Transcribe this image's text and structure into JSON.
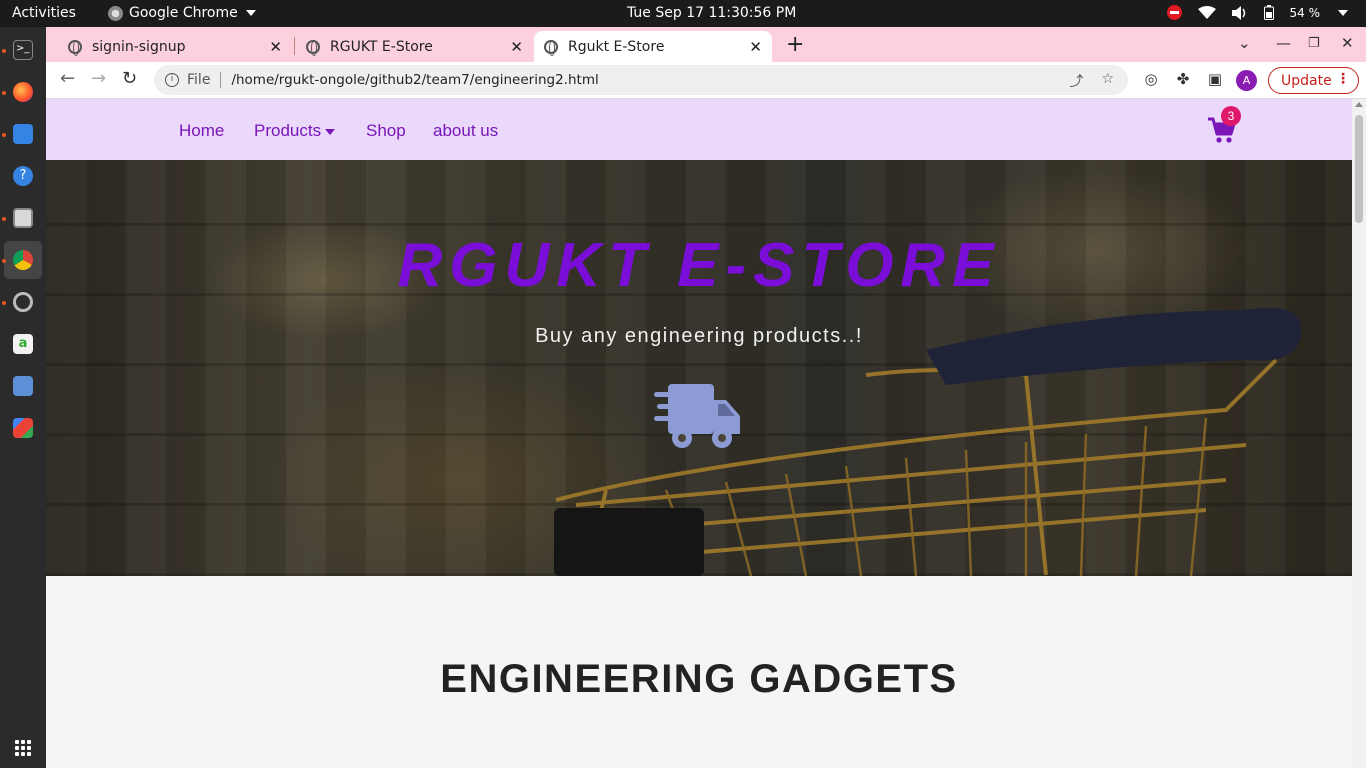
{
  "topbar": {
    "activities": "Activities",
    "app_name": "Google Chrome",
    "clock": "Tue Sep 17  11:30:56 PM",
    "battery": "54 %"
  },
  "dock": {
    "items": [
      "terminal-icon",
      "firefox-icon",
      "text-editor-icon",
      "help-icon",
      "files-icon",
      "chrome-icon",
      "settings-icon",
      "software-icon",
      "package-icon",
      "gmail-icon",
      "show-apps-icon"
    ]
  },
  "browser": {
    "tabs": [
      {
        "title": "signin-signup"
      },
      {
        "title": "RGUKT E-Store"
      },
      {
        "title": "Rgukt E-Store"
      }
    ],
    "new_tab_label": "+",
    "omnibox": {
      "scheme_label": "File",
      "url": "/home/rgukt-ongole/github2/team7/engineering2.html"
    },
    "avatar_letter": "A",
    "update_label": "Update"
  },
  "site": {
    "nav": {
      "home": "Home",
      "products": "Products",
      "shop": "Shop",
      "about": "about us"
    },
    "cart_count": "3",
    "hero": {
      "title": "RGUKT E-STORE",
      "subtitle": "Buy any engineering products..!"
    },
    "section_title": "ENGINEERING GADGETS"
  },
  "colors": {
    "tabbar": "#fcd1dd",
    "nav_bg": "#ead9fb",
    "brand_purple": "#7a0ed8",
    "link_purple": "#7a16b8",
    "badge": "#e0186c",
    "truck": "#8d9bd4"
  }
}
